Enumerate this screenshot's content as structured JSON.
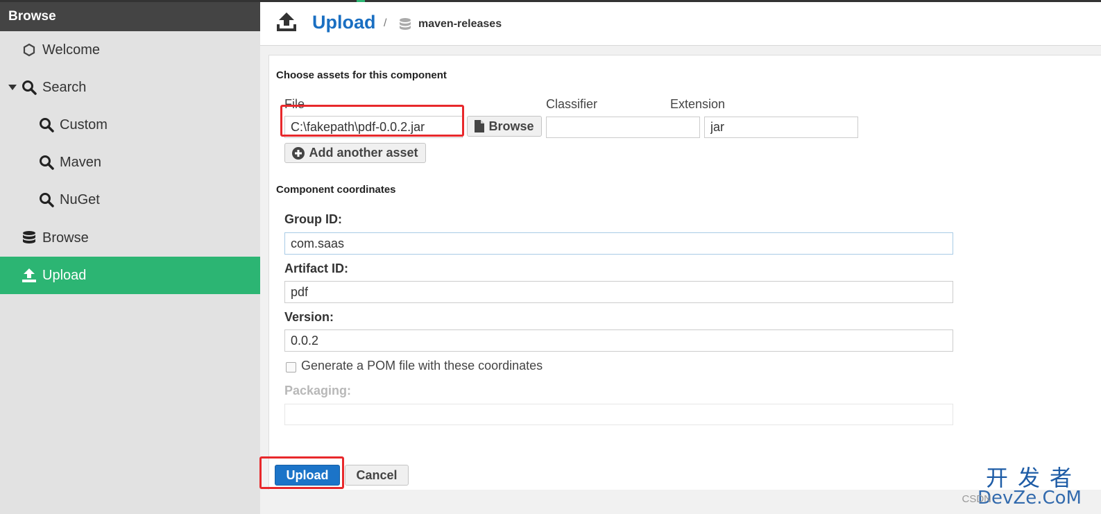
{
  "sidebar": {
    "header": "Browse",
    "items": [
      {
        "label": "Welcome"
      },
      {
        "label": "Search"
      },
      {
        "label": "Custom"
      },
      {
        "label": "Maven"
      },
      {
        "label": "NuGet"
      },
      {
        "label": "Browse"
      },
      {
        "label": "Upload"
      }
    ]
  },
  "header": {
    "title": "Upload",
    "separator": "/",
    "repository": "maven-releases"
  },
  "assets": {
    "section_title": "Choose assets for this component",
    "file_label": "File",
    "file_value": "C:\\fakepath\\pdf-0.0.2.jar",
    "browse_label": "Browse",
    "classifier_label": "Classifier",
    "classifier_value": "",
    "extension_label": "Extension",
    "extension_value": "jar",
    "add_asset_label": "Add another asset"
  },
  "coordinates": {
    "section_title": "Component coordinates",
    "group_label": "Group ID:",
    "group_value": "com.saas",
    "artifact_label": "Artifact ID:",
    "artifact_value": "pdf",
    "version_label": "Version:",
    "version_value": "0.0.2",
    "generate_pom_label": "Generate a POM file with these coordinates",
    "generate_pom_checked": false,
    "packaging_label": "Packaging:",
    "packaging_value": ""
  },
  "actions": {
    "upload_label": "Upload",
    "cancel_label": "Cancel"
  },
  "watermark": {
    "cn": "开发者",
    "en": "DevZe.CoM",
    "csdn": "CSDN"
  },
  "colors": {
    "accent_green": "#2cb573",
    "primary_blue": "#1c74c8",
    "highlight_red": "#e8282b"
  }
}
